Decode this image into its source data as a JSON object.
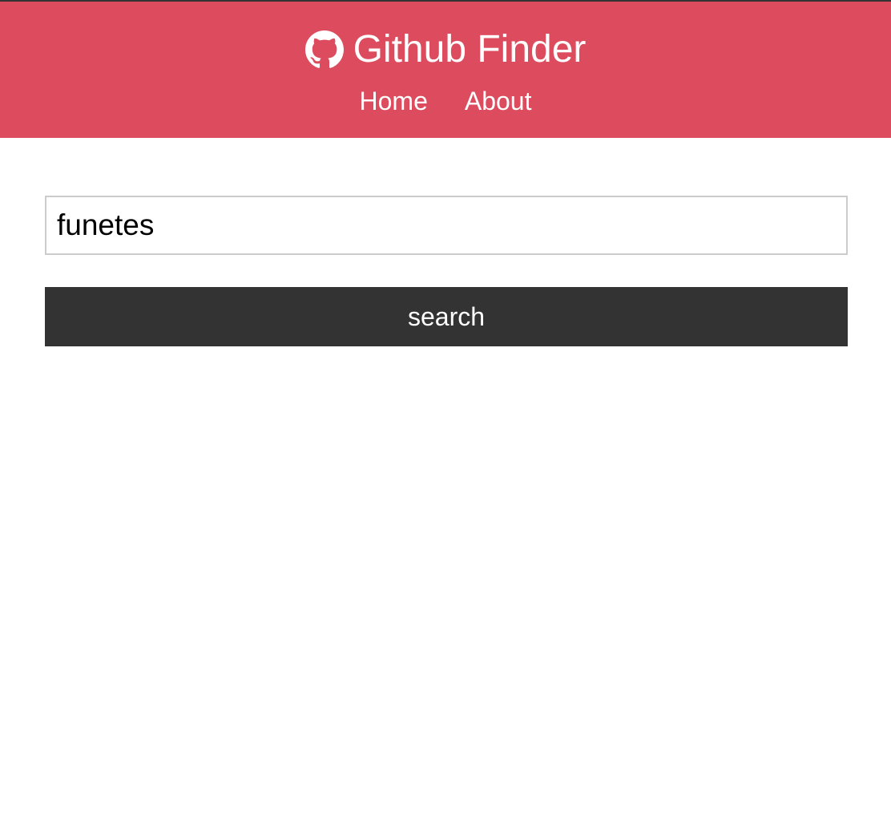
{
  "colors": {
    "navbar_bg": "#dc4c5e",
    "button_bg": "#333333",
    "text_light": "#ffffff",
    "input_border": "#cccccc"
  },
  "navbar": {
    "brand_icon": "github-icon",
    "title": "Github Finder",
    "links": [
      {
        "label": "Home"
      },
      {
        "label": "About"
      }
    ]
  },
  "search": {
    "value": "funetes",
    "button_label": "search"
  }
}
